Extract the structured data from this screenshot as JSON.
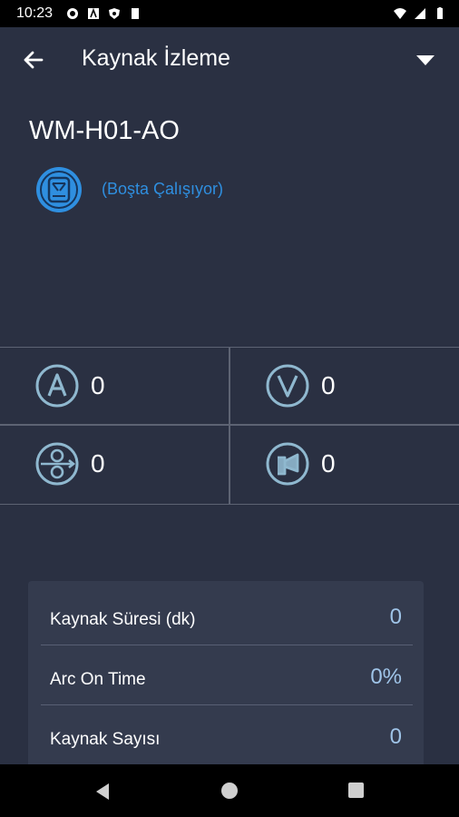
{
  "status_bar": {
    "time": "10:23"
  },
  "app_bar": {
    "title": "Kaynak İzleme"
  },
  "device": {
    "name": "WM-H01-AO",
    "status": "(Boşta Çalışıyor)"
  },
  "metrics": [
    {
      "icon": "ampere-icon",
      "value": "0"
    },
    {
      "icon": "voltage-icon",
      "value": "0"
    },
    {
      "icon": "wire-feed-icon",
      "value": "0"
    },
    {
      "icon": "gas-flow-icon",
      "value": "0"
    }
  ],
  "stats": [
    {
      "label": "Kaynak Süresi (dk)",
      "value": "0"
    },
    {
      "label": "Arc On Time",
      "value": "0%"
    },
    {
      "label": "Kaynak Sayısı",
      "value": "0"
    }
  ],
  "colors": {
    "accent": "#2f8fe0",
    "background": "#2a3042",
    "card": "#343b4e",
    "metric_icon": "#8fb8cf"
  }
}
